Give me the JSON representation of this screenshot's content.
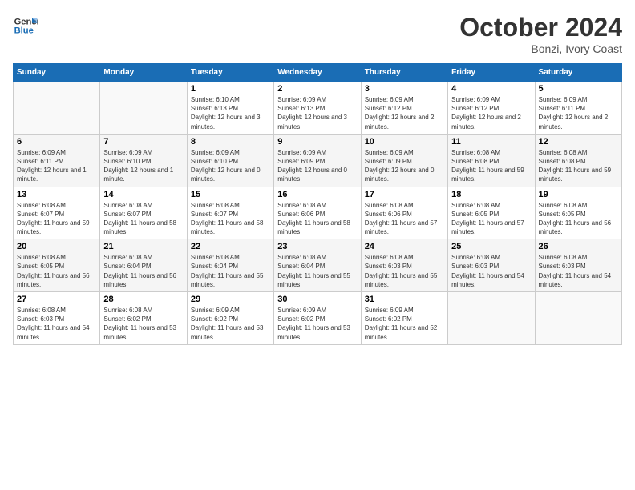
{
  "header": {
    "logo_line1": "General",
    "logo_line2": "Blue",
    "month_title": "October 2024",
    "location": "Bonzi, Ivory Coast"
  },
  "days_of_week": [
    "Sunday",
    "Monday",
    "Tuesday",
    "Wednesday",
    "Thursday",
    "Friday",
    "Saturday"
  ],
  "weeks": [
    [
      {
        "day": "",
        "info": ""
      },
      {
        "day": "",
        "info": ""
      },
      {
        "day": "1",
        "info": "Sunrise: 6:10 AM\nSunset: 6:13 PM\nDaylight: 12 hours and 3 minutes."
      },
      {
        "day": "2",
        "info": "Sunrise: 6:09 AM\nSunset: 6:13 PM\nDaylight: 12 hours and 3 minutes."
      },
      {
        "day": "3",
        "info": "Sunrise: 6:09 AM\nSunset: 6:12 PM\nDaylight: 12 hours and 2 minutes."
      },
      {
        "day": "4",
        "info": "Sunrise: 6:09 AM\nSunset: 6:12 PM\nDaylight: 12 hours and 2 minutes."
      },
      {
        "day": "5",
        "info": "Sunrise: 6:09 AM\nSunset: 6:11 PM\nDaylight: 12 hours and 2 minutes."
      }
    ],
    [
      {
        "day": "6",
        "info": "Sunrise: 6:09 AM\nSunset: 6:11 PM\nDaylight: 12 hours and 1 minute."
      },
      {
        "day": "7",
        "info": "Sunrise: 6:09 AM\nSunset: 6:10 PM\nDaylight: 12 hours and 1 minute."
      },
      {
        "day": "8",
        "info": "Sunrise: 6:09 AM\nSunset: 6:10 PM\nDaylight: 12 hours and 0 minutes."
      },
      {
        "day": "9",
        "info": "Sunrise: 6:09 AM\nSunset: 6:09 PM\nDaylight: 12 hours and 0 minutes."
      },
      {
        "day": "10",
        "info": "Sunrise: 6:09 AM\nSunset: 6:09 PM\nDaylight: 12 hours and 0 minutes."
      },
      {
        "day": "11",
        "info": "Sunrise: 6:08 AM\nSunset: 6:08 PM\nDaylight: 11 hours and 59 minutes."
      },
      {
        "day": "12",
        "info": "Sunrise: 6:08 AM\nSunset: 6:08 PM\nDaylight: 11 hours and 59 minutes."
      }
    ],
    [
      {
        "day": "13",
        "info": "Sunrise: 6:08 AM\nSunset: 6:07 PM\nDaylight: 11 hours and 59 minutes."
      },
      {
        "day": "14",
        "info": "Sunrise: 6:08 AM\nSunset: 6:07 PM\nDaylight: 11 hours and 58 minutes."
      },
      {
        "day": "15",
        "info": "Sunrise: 6:08 AM\nSunset: 6:07 PM\nDaylight: 11 hours and 58 minutes."
      },
      {
        "day": "16",
        "info": "Sunrise: 6:08 AM\nSunset: 6:06 PM\nDaylight: 11 hours and 58 minutes."
      },
      {
        "day": "17",
        "info": "Sunrise: 6:08 AM\nSunset: 6:06 PM\nDaylight: 11 hours and 57 minutes."
      },
      {
        "day": "18",
        "info": "Sunrise: 6:08 AM\nSunset: 6:05 PM\nDaylight: 11 hours and 57 minutes."
      },
      {
        "day": "19",
        "info": "Sunrise: 6:08 AM\nSunset: 6:05 PM\nDaylight: 11 hours and 56 minutes."
      }
    ],
    [
      {
        "day": "20",
        "info": "Sunrise: 6:08 AM\nSunset: 6:05 PM\nDaylight: 11 hours and 56 minutes."
      },
      {
        "day": "21",
        "info": "Sunrise: 6:08 AM\nSunset: 6:04 PM\nDaylight: 11 hours and 56 minutes."
      },
      {
        "day": "22",
        "info": "Sunrise: 6:08 AM\nSunset: 6:04 PM\nDaylight: 11 hours and 55 minutes."
      },
      {
        "day": "23",
        "info": "Sunrise: 6:08 AM\nSunset: 6:04 PM\nDaylight: 11 hours and 55 minutes."
      },
      {
        "day": "24",
        "info": "Sunrise: 6:08 AM\nSunset: 6:03 PM\nDaylight: 11 hours and 55 minutes."
      },
      {
        "day": "25",
        "info": "Sunrise: 6:08 AM\nSunset: 6:03 PM\nDaylight: 11 hours and 54 minutes."
      },
      {
        "day": "26",
        "info": "Sunrise: 6:08 AM\nSunset: 6:03 PM\nDaylight: 11 hours and 54 minutes."
      }
    ],
    [
      {
        "day": "27",
        "info": "Sunrise: 6:08 AM\nSunset: 6:03 PM\nDaylight: 11 hours and 54 minutes."
      },
      {
        "day": "28",
        "info": "Sunrise: 6:08 AM\nSunset: 6:02 PM\nDaylight: 11 hours and 53 minutes."
      },
      {
        "day": "29",
        "info": "Sunrise: 6:09 AM\nSunset: 6:02 PM\nDaylight: 11 hours and 53 minutes."
      },
      {
        "day": "30",
        "info": "Sunrise: 6:09 AM\nSunset: 6:02 PM\nDaylight: 11 hours and 53 minutes."
      },
      {
        "day": "31",
        "info": "Sunrise: 6:09 AM\nSunset: 6:02 PM\nDaylight: 11 hours and 52 minutes."
      },
      {
        "day": "",
        "info": ""
      },
      {
        "day": "",
        "info": ""
      }
    ]
  ]
}
